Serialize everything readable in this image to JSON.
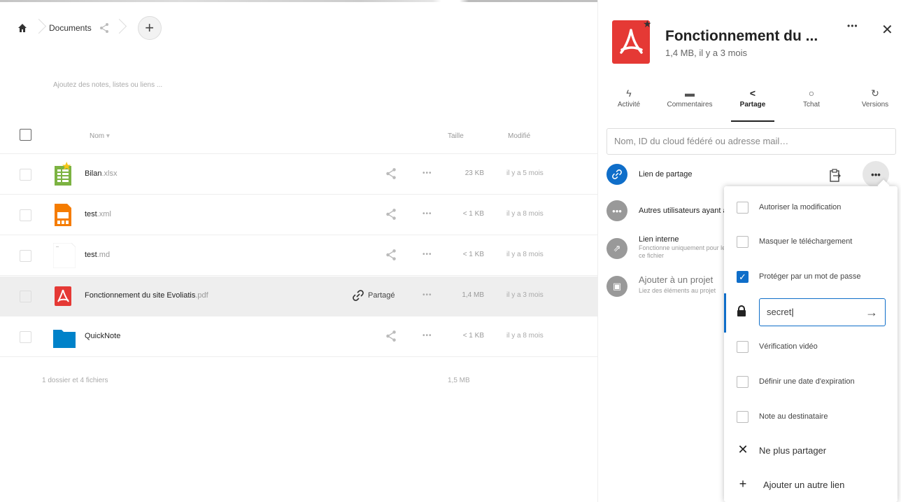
{
  "breadcrumb": {
    "home_icon": "home-icon",
    "folder": "Documents"
  },
  "notes_hint": "Ajoutez des notes, listes ou liens ...",
  "table": {
    "col_name": "Nom",
    "col_size": "Taille",
    "col_modified": "Modifié",
    "rows": [
      {
        "name": "Bilan",
        "ext": ".xlsx",
        "size": "23 KB",
        "modified": "il y a 5 mois",
        "icon": "spreadsheet-icon",
        "starred": true
      },
      {
        "name": "test",
        "ext": ".xml",
        "size": "< 1 KB",
        "modified": "il y a 8 mois",
        "icon": "presentation-icon"
      },
      {
        "name": "test",
        "ext": ".md",
        "size": "< 1 KB",
        "modified": "il y a 8 mois",
        "icon": "text-file-icon"
      },
      {
        "name": "Fonctionnement du site Evoliatis",
        "ext": ".pdf",
        "size": "1,4 MB",
        "modified": "il y a 3 mois",
        "icon": "pdf-icon",
        "shared_label": "Partagé",
        "selected": true
      },
      {
        "name": "QuickNote",
        "ext": "",
        "size": "< 1 KB",
        "modified": "il y a 8 mois",
        "icon": "folder-icon"
      }
    ],
    "summary": "1 dossier et 4 fichiers",
    "summary_size": "1,5 MB",
    "more_glyph": "•••"
  },
  "sidebar": {
    "title": "Fonctionnement du ...",
    "subtitle": "1,4 MB, il y a 3 mois",
    "tabs": [
      {
        "label": "Activité"
      },
      {
        "label": "Commentaires"
      },
      {
        "label": "Partage",
        "active": true
      },
      {
        "label": "Tchat"
      },
      {
        "label": "Versions"
      }
    ],
    "share_placeholder": "Nom, ID du cloud fédéré ou adresse mail…",
    "share_link_label": "Lien de partage",
    "others_label": "Autres utilisateurs ayant accès",
    "internal_link_label": "Lien interne",
    "internal_link_sub1": "Fonctionne uniquement pour les utilisateurs ayant accès à",
    "internal_link_sub2": "ce fichier",
    "project_label": "Ajouter à un projet",
    "project_sub": "Liez des éléments au projet",
    "menu": {
      "allow_edit": "Autoriser la modification",
      "hide_download": "Masquer le téléchargement",
      "password_protect": "Protéger par un mot de passe",
      "password_value": "secret",
      "video_verify": "Vérification vidéo",
      "expiration": "Définir une date d'expiration",
      "note": "Note au destinataire",
      "unshare": "Ne plus partager",
      "add_link": "Ajouter un autre lien"
    }
  },
  "colors": {
    "accent": "#0f6ec9",
    "pdf": "#e53935",
    "folder": "#0082c9",
    "sheet": "#7cb342",
    "slides": "#f57c00"
  }
}
